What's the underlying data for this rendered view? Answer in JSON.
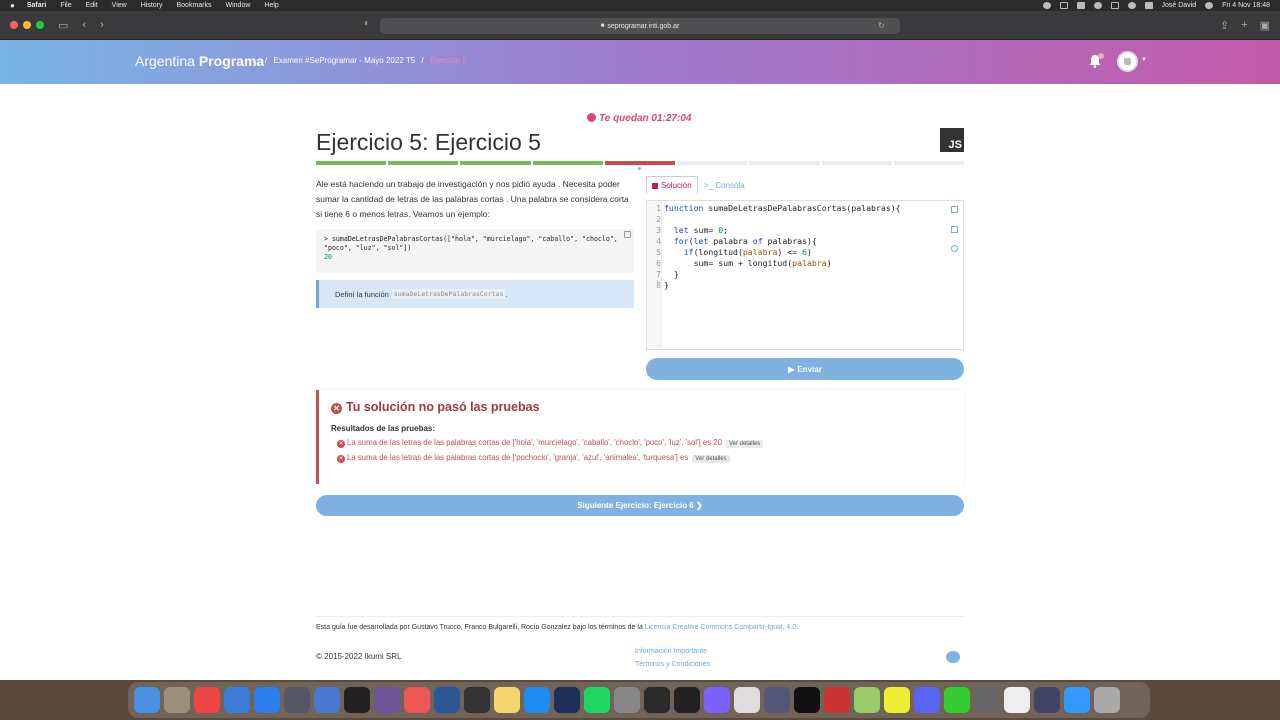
{
  "menubar": {
    "app": "Safari",
    "items": [
      "File",
      "Edit",
      "View",
      "History",
      "Bookmarks",
      "Window",
      "Help"
    ],
    "user": "José David",
    "datetime": "Fri 4 Nov  18:48"
  },
  "browser": {
    "url": "seprogramar.inti.gob.ar"
  },
  "header": {
    "brand_light": "Argentina ",
    "brand_bold": "Programa",
    "crumb_1": "Examen #SeProgramar - Mayo 2022 T5",
    "crumb_sep": "/",
    "crumb_2": "Ejercicio 5"
  },
  "timer": "Te quedan 01:27:04",
  "exercise": {
    "title": "Ejercicio 5: Ejercicio 5",
    "language_badge": "JS",
    "progress": [
      "ok",
      "ok",
      "ok",
      "ok",
      "bad",
      "none",
      "none",
      "none",
      "none"
    ],
    "description": "Ale está haciendo un trabajo de investigación y nos pidió ayuda . Necesita poder sumar la cantidad de letras de las palabras cortas . Una palabra se considera corta si tiene 6 o menos letras. Veamos un ejemplo:",
    "example_line1": "> sumaDeLetrasDePalabrasCortas([\"hola\", \"murcielago\", \"caballo\", \"choclo\", \"poco\", \"luz\", \"sol\"])",
    "example_result": "20",
    "hint_text": "Definí la función",
    "hint_code": "sumaDeLetrasDePalabrasCortas",
    "hint_end": "."
  },
  "editor": {
    "tab_solution": "Solución",
    "tab_console": ">_ Consola",
    "send_label": "Enviar"
  },
  "result": {
    "title": "Tu solución no pasó las pruebas",
    "subtitle": "Resultados de las pruebas:",
    "tests": [
      {
        "text": "La suma de las letras de las palabras cortas de ['hola', 'murcielago', 'caballo', 'choclo', 'poco', 'luz', 'sol'] es 20",
        "details": "Ver detalles"
      },
      {
        "text": "La suma de las letras de las palabras cortas de ['pochoclo', 'granja', 'azul', 'animales', 'turquesa'] es",
        "details": "Ver detalles"
      }
    ]
  },
  "next_label": "Siguiente Ejercicio: Ejercicio 6 ❯",
  "footer": {
    "guide_text": "Esta guía fue desarrollada por Gustavo Trucco, Franco Bulgarelli, Rocío Gonzalez bajo los términos de la ",
    "license": "Licencia Creative Commons Compartir-Igual, 4.0",
    "guide_end": ".",
    "copyright": "© 2015-2022 Ikumi SRL",
    "link_info": "Información Importante",
    "link_terms": "Términos y Condiciones"
  },
  "colors": {
    "accent": "#79b5e6",
    "error": "#c24f4f",
    "success": "#7ab85c",
    "timer": "#d9467e"
  }
}
